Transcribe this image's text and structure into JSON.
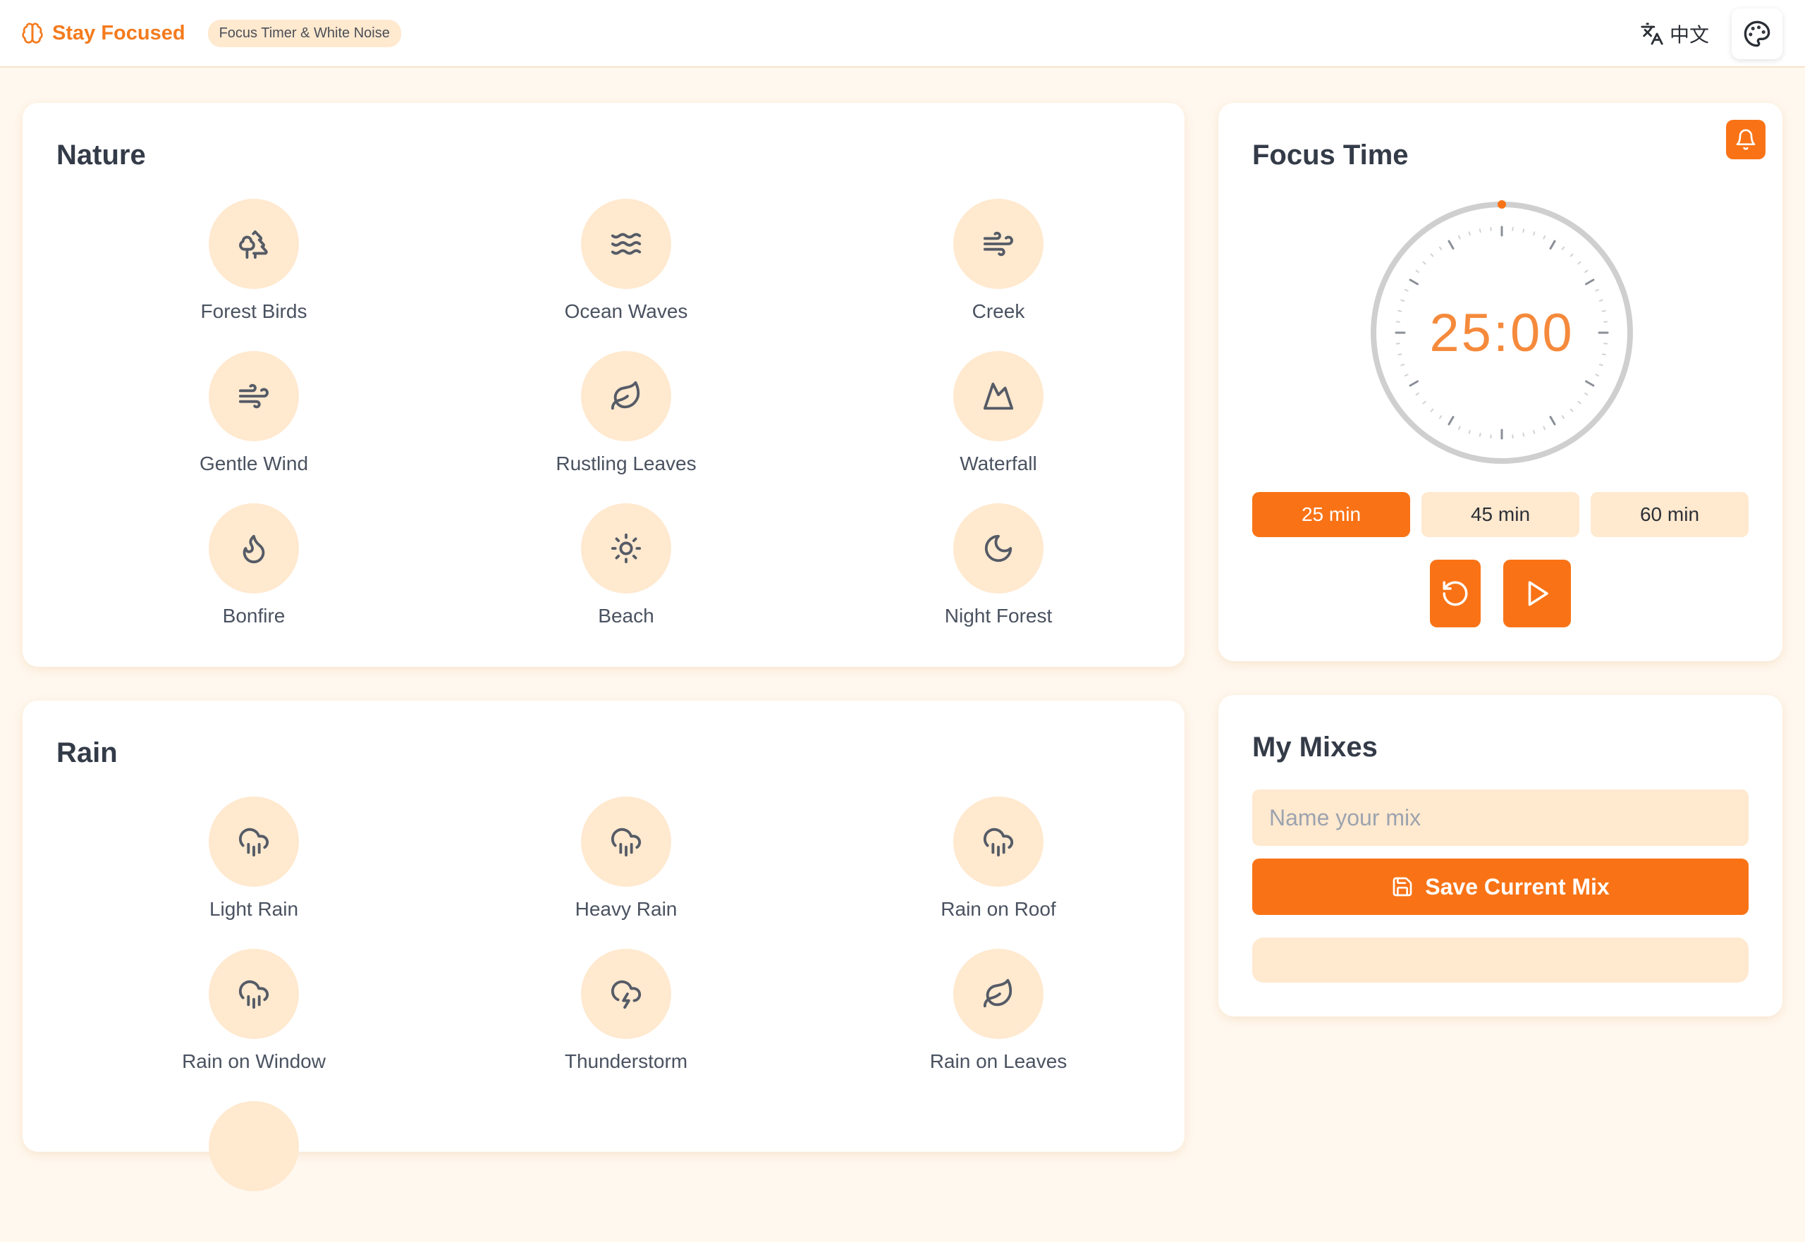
{
  "colors": {
    "accent": "#f97316",
    "accent_text": "#f47b1e",
    "soft": "#ffe9cf",
    "background": "#fff8ef"
  },
  "header": {
    "brand_icon": "brain-icon",
    "brand_name": "Stay Focused",
    "tagline": "Focus Timer & White Noise",
    "language_icon": "translate-icon",
    "language_label": "中文",
    "theme_icon": "palette-icon"
  },
  "nature": {
    "title": "Nature",
    "sounds": [
      {
        "label": "Forest Birds",
        "icon": "trees-icon"
      },
      {
        "label": "Ocean Waves",
        "icon": "waves-icon"
      },
      {
        "label": "Creek",
        "icon": "wind-icon"
      },
      {
        "label": "Gentle Wind",
        "icon": "wind-icon"
      },
      {
        "label": "Rustling Leaves",
        "icon": "leaf-icon"
      },
      {
        "label": "Waterfall",
        "icon": "mountain-icon"
      },
      {
        "label": "Bonfire",
        "icon": "flame-icon"
      },
      {
        "label": "Beach",
        "icon": "sun-icon"
      },
      {
        "label": "Night Forest",
        "icon": "moon-icon"
      }
    ]
  },
  "rain": {
    "title": "Rain",
    "sounds": [
      {
        "label": "Light Rain",
        "icon": "cloud-rain-icon"
      },
      {
        "label": "Heavy Rain",
        "icon": "cloud-rain-icon"
      },
      {
        "label": "Rain on Roof",
        "icon": "cloud-rain-icon"
      },
      {
        "label": "Rain on Window",
        "icon": "cloud-rain-icon"
      },
      {
        "label": "Thunderstorm",
        "icon": "cloud-lightning-icon"
      },
      {
        "label": "Rain on Leaves",
        "icon": "leaf-icon"
      }
    ]
  },
  "timer": {
    "title": "Focus Time",
    "bell_icon": "bell-icon",
    "display": "25:00",
    "progress": 0,
    "presets": [
      "25 min",
      "45 min",
      "60 min"
    ],
    "active_preset": "25 min",
    "reset_icon": "rotate-ccw-icon",
    "play_icon": "play-icon"
  },
  "mixes": {
    "title": "My Mixes",
    "input_placeholder": "Name your mix",
    "input_value": "",
    "save_icon": "save-icon",
    "save_label": "Save Current Mix"
  }
}
